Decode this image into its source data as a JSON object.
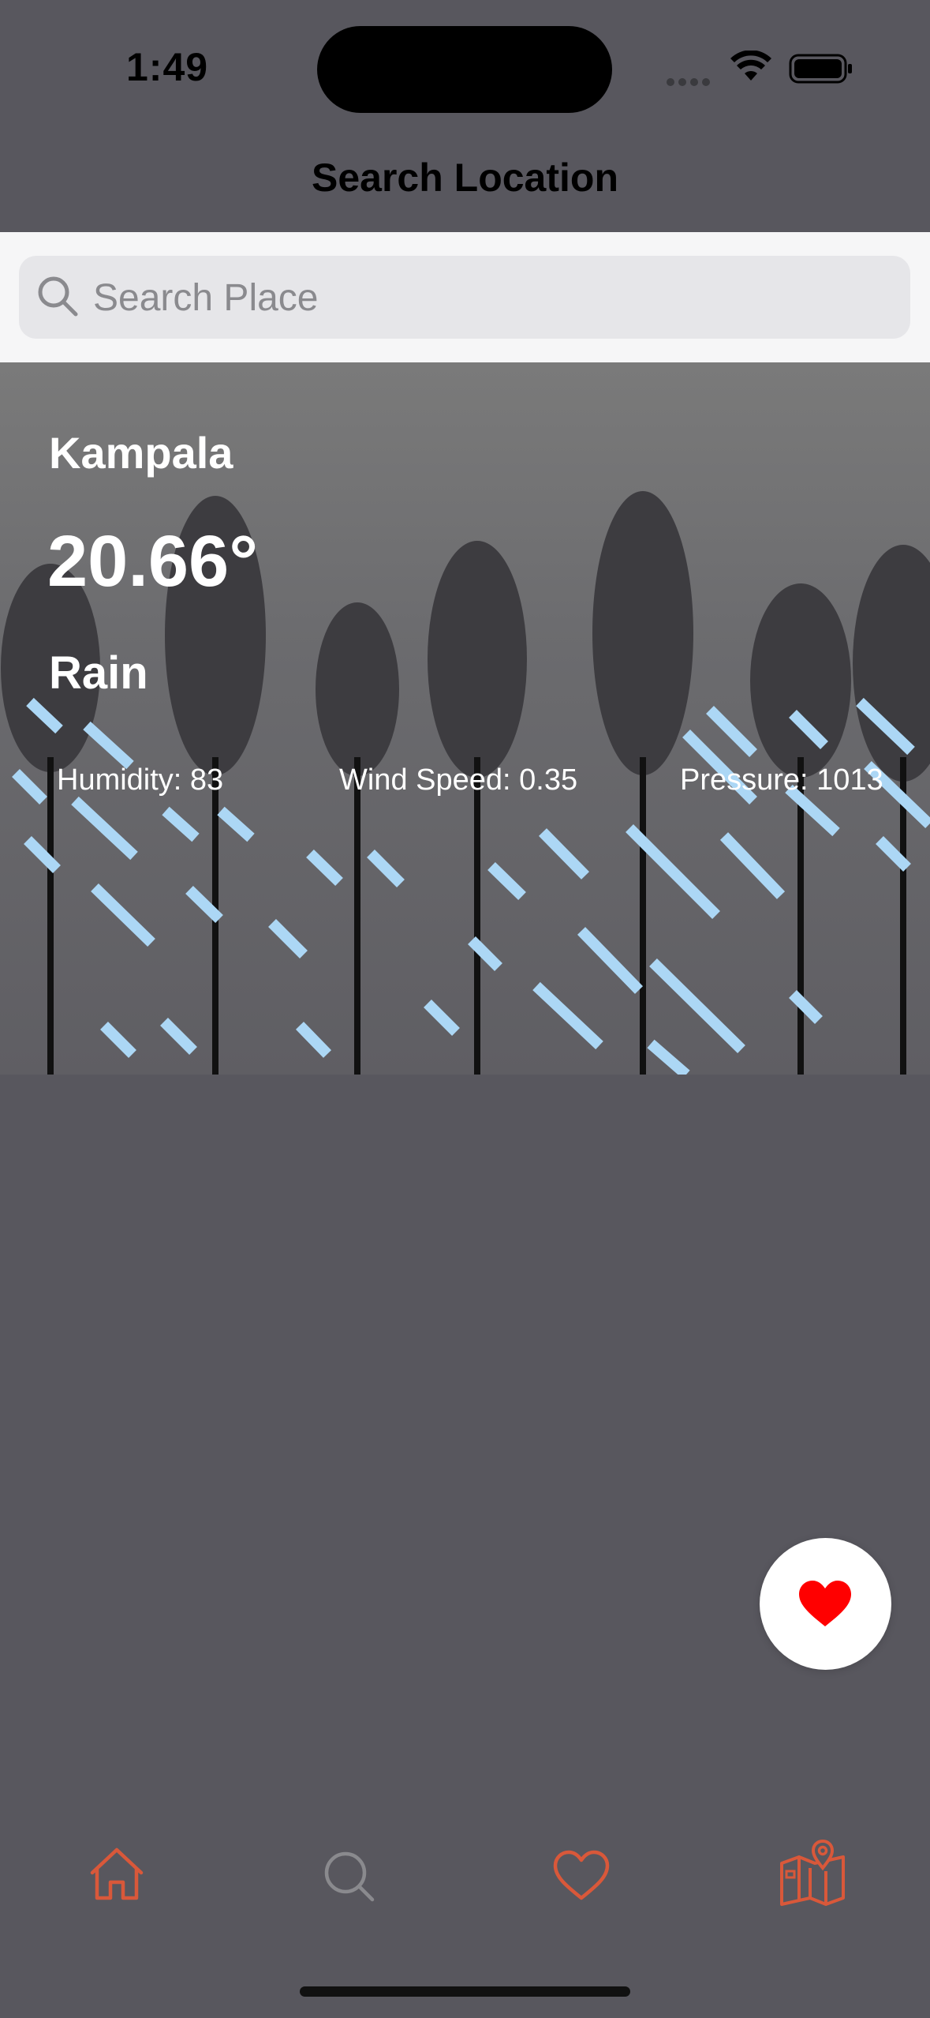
{
  "status_bar": {
    "time": "1:49",
    "icons": [
      "signal-icon",
      "wifi-icon",
      "battery-icon"
    ]
  },
  "header": {
    "title": "Search Location"
  },
  "search": {
    "placeholder": "Search Place",
    "value": "",
    "icon": "search-icon"
  },
  "weather": {
    "city": "Kampala",
    "temperature": "20.66°",
    "condition": "Rain",
    "humidity": "Humidity: 83",
    "wind_speed": "Wind Speed: 0.35",
    "pressure": "Pressure: 1013",
    "illustration": "rain-forest-illustration"
  },
  "favorite_button": {
    "icon": "heart-icon",
    "color": "#ff0000"
  },
  "tab_bar": {
    "items": [
      {
        "name": "home",
        "icon": "home-icon",
        "color": "#d9583a"
      },
      {
        "name": "search",
        "icon": "search-icon",
        "color": "#8a8a8e"
      },
      {
        "name": "favorites",
        "icon": "heart-outline-icon",
        "color": "#d9583a"
      },
      {
        "name": "map",
        "icon": "map-icon",
        "color": "#d9583a"
      }
    ]
  },
  "colors": {
    "rain": "#acd7f5",
    "tree": "#3d3c40",
    "accent": "#d9583a",
    "background": "#58575e"
  }
}
